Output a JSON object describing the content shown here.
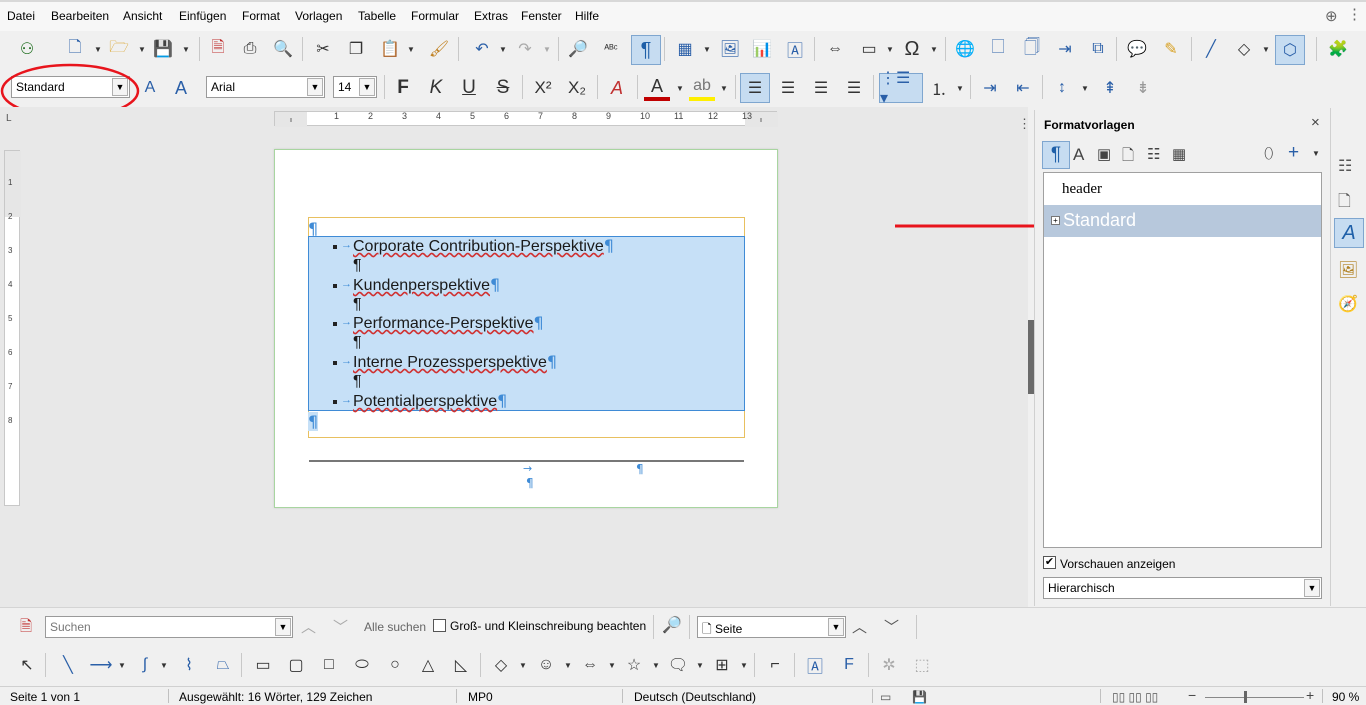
{
  "menu": [
    "Datei",
    "Bearbeiten",
    "Ansicht",
    "Einfügen",
    "Format",
    "Vorlagen",
    "Tabelle",
    "Formular",
    "Extras",
    "Fenster",
    "Hilfe"
  ],
  "formatting": {
    "paragraph_style": "Standard",
    "font_name": "Arial",
    "font_size": "14"
  },
  "document": {
    "items": [
      "Corporate Contribution-Perspektive",
      "Kundenperspektive",
      "Performance-Perspektive",
      "Interne Prozessperspektive",
      "Potentialperspektive"
    ],
    "pilcrow": "¶",
    "tab_arrow": "→"
  },
  "ruler": {
    "h_ticks": [
      "1",
      "2",
      "3",
      "4",
      "5",
      "6",
      "7",
      "8",
      "9",
      "10",
      "11",
      "12",
      "13"
    ],
    "v_ticks": [
      "1",
      "2",
      "3",
      "4",
      "5",
      "6",
      "7",
      "8"
    ]
  },
  "sidebar": {
    "title": "Formatvorlagen",
    "styles": [
      "header",
      "Standard"
    ],
    "selected_style": "Standard",
    "preview_label": "Vorschauen anzeigen",
    "preview_checked": true,
    "filter": "Hierarchisch"
  },
  "findbar": {
    "search_placeholder": "Suchen",
    "find_all": "Alle suchen",
    "match_case": "Groß- und Kleinschreibung beachten",
    "search_scope": "Seite"
  },
  "status": {
    "page": "Seite 1 von 1",
    "selection": "Ausgewählt: 16 Wörter, 129 Zeichen",
    "page_style": "MP0",
    "language": "Deutsch (Deutschland)",
    "zoom": "90 %"
  },
  "colors": {
    "selection": "#c6e0f7",
    "annotation": "#e8141c",
    "pilcrow": "#3f8bd6",
    "selected_style_bg": "#b7c8dc"
  }
}
